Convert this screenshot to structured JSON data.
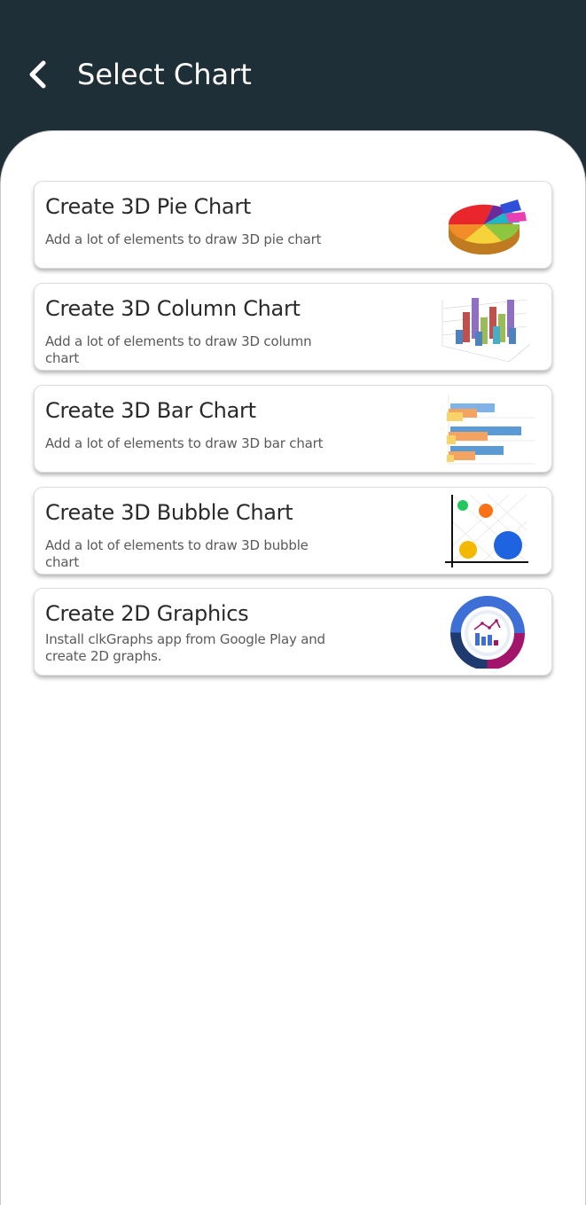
{
  "header": {
    "title": "Select Chart",
    "back_icon": "chevron-left-icon"
  },
  "colors": {
    "appbar": "#1f2f38",
    "sheet": "#ffffff",
    "title_text": "#ffffff"
  },
  "cards": [
    {
      "title": "Create 3D Pie Chart",
      "subtitle": "Add a lot of elements to draw 3D pie chart",
      "thumbnail": "3d-pie-chart-thumbnail"
    },
    {
      "title": "Create 3D Column Chart",
      "subtitle": "Add a lot of elements to draw 3D column chart",
      "thumbnail": "3d-column-chart-thumbnail"
    },
    {
      "title": "Create 3D Bar Chart",
      "subtitle": "Add a lot of elements to draw 3D bar chart",
      "thumbnail": "3d-bar-chart-thumbnail"
    },
    {
      "title": "Create 3D Bubble Chart",
      "subtitle": "Add a lot of elements to draw 3D bubble chart",
      "thumbnail": "3d-bubble-chart-thumbnail"
    },
    {
      "title": "Create 2D Graphics",
      "subtitle": "Install clkGraphs app from Google Play and create 2D graphs.",
      "thumbnail": "clkgraphs-app-logo"
    }
  ]
}
